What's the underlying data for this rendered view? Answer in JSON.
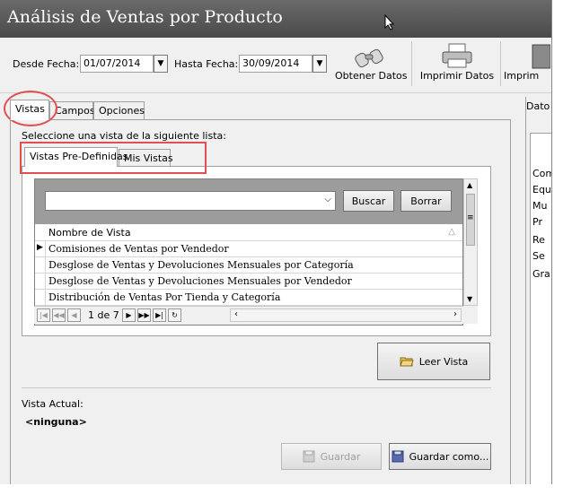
{
  "window": {
    "title": "Análisis de Ventas por Producto"
  },
  "toolbar": {
    "desde_label": "Desde Fecha:",
    "desde_value": "01/07/2014",
    "hasta_label": "Hasta Fecha:",
    "hasta_value": "30/09/2014",
    "obtener_label": "Obtener Datos",
    "imprimir_label": "Imprimir Datos",
    "imprimir2_label": "Imprim"
  },
  "tabs": [
    "Vistas",
    "Campos",
    "Opciones"
  ],
  "instruction": "Seleccione una vista de la siguiente lista:",
  "subtabs": [
    "Vistas Pre-Definidas",
    "Mis Vistas"
  ],
  "grid": {
    "search_value": "",
    "buscar_label": "Buscar",
    "borrar_label": "Borrar",
    "column_header": "Nombre de Vista",
    "rows": [
      "Comisiones de Ventas por Vendedor",
      "Desglose de Ventas y Devoluciones Mensuales por Categoría",
      "Desglose de Ventas y Devoluciones Mensuales por Vendedor",
      "Distribución de Ventas Por Tienda y Categoría"
    ],
    "page_indicator": "1 de 7"
  },
  "leer_label": "Leer Vista",
  "vista_actual_label": "Vista Actual:",
  "vista_actual_value": "<ninguna>",
  "guardar_label": "Guardar",
  "guardar_como_label": "Guardar como...",
  "right_panel": {
    "header": "Dato",
    "items": [
      "Com",
      "Equ",
      "Mu",
      "Pr",
      "Re",
      "Se",
      "Gra"
    ]
  },
  "colors": {
    "titlebar": "#555555",
    "annotation": "#e05050",
    "grid_header": "#9c9c9c"
  }
}
